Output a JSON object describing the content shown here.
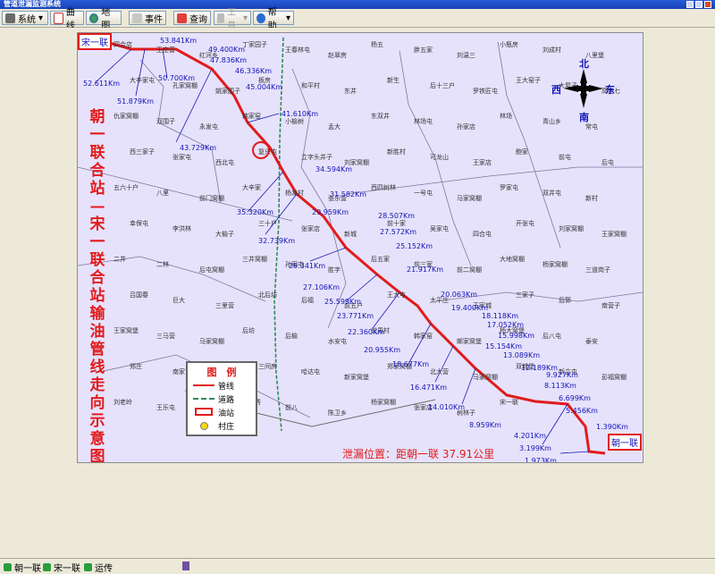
{
  "window": {
    "title": "管道泄漏监测系统"
  },
  "toolbar": {
    "system": "系统",
    "curve": "曲线",
    "map": "地图",
    "event": "事件",
    "query": "查询",
    "tools": "工具",
    "help": "帮助"
  },
  "map": {
    "vertical_title": "朝一联合站—宋一联合站输油管线走向示意图",
    "station_start": "宋一联",
    "station_end": "朝一联",
    "leak_text": "泄漏位置：距朝一联 37.91公里",
    "compass": {
      "north": "北",
      "south": "南",
      "east": "东",
      "west": "西"
    },
    "legend": {
      "title": "图　例",
      "items": [
        "管线",
        "道路",
        "油站",
        "村庄"
      ]
    },
    "distances": [
      "53.841Km",
      "52.611Km",
      "51.879Km",
      "50.700Km",
      "49.400Km",
      "47.836Km",
      "46.336Km",
      "45.004Km",
      "43.729Km",
      "41.610Km",
      "35.320Km",
      "34.594Km",
      "32.739Km",
      "31.582Km",
      "29.959Km",
      "29.341Km",
      "28.507Km",
      "27.572Km",
      "27.106Km",
      "25.599Km",
      "25.152Km",
      "23.771Km",
      "22.360Km",
      "21.917Km",
      "20.955Km",
      "20.063Km",
      "19.400Km",
      "18.677Km",
      "18.118Km",
      "17.052Km",
      "16.471Km",
      "15.998Km",
      "15.154Km",
      "14.010Km",
      "13.089Km",
      "12.189Km",
      "9.927Km",
      "8.959Km",
      "8.113Km",
      "6.699Km",
      "5.456Km",
      "4.201Km",
      "3.199Km",
      "1.973Km",
      "1.390Km"
    ],
    "places": [
      "四合店",
      "王空营",
      "红河乡",
      "丁家园子",
      "王春林屯",
      "赵翠房",
      "杨五",
      "胖五家",
      "刘温三",
      "小瓶房",
      "刘成村",
      "八里堡",
      "大辛家屯",
      "孔家窝棚",
      "姚家围子",
      "板房",
      "和平村",
      "东井",
      "新生",
      "后十三户",
      "罗铁匠屯",
      "王大窑子",
      "大屋子",
      "高老七",
      "仇家窝棚",
      "双围子",
      "永发屯",
      "韩家窑",
      "小榆树",
      "孟大",
      "东双井",
      "林场屯",
      "孙家店",
      "林场",
      "青山乡",
      "常屯",
      "西三家子",
      "张家屯",
      "西北屯",
      "复兴屯",
      "立字头井子",
      "刘家窝棚",
      "新胜村",
      "可龙山",
      "王家店",
      "鲍家",
      "前屯",
      "后屯",
      "五六十户",
      "八里",
      "前门窝棚",
      "大辛家",
      "杨发村",
      "张乐营",
      "西四树林",
      "一号屯",
      "马家窝棚",
      "罗家屯",
      "双井屯",
      "新村",
      "幸保屯",
      "李洪林",
      "大榆子",
      "三十户",
      "张家店",
      "新城",
      "前十家",
      "吴家屯",
      "四合屯",
      "开张屯",
      "刘家窝棚",
      "王家窝棚",
      "二井",
      "二林",
      "后屯窝棚",
      "三井窝棚",
      "孙家屯",
      "胜字",
      "后五家",
      "前三家",
      "前二窝棚",
      "大地窝棚",
      "杨家窝棚",
      "三道岗子",
      "吕国春",
      "巨大",
      "三里营",
      "北后坊",
      "后福",
      "前五户",
      "王大屯",
      "太平庄",
      "王家城",
      "三家子",
      "后郭",
      "南营子",
      "王家窝堡",
      "三马营",
      "马家窝棚",
      "后坊",
      "后榆",
      "水安屯",
      "前周村",
      "韩家窑",
      "邮家窝堡",
      "杨大窝堡",
      "后八屯",
      "泰安",
      "郑庄",
      "南家屯",
      "山门",
      "三间房",
      "哈达屯",
      "新家窝堡",
      "郑家窝棚",
      "北大营",
      "马家窝棚",
      "双城堡",
      "新立屯",
      "彭福窝棚",
      "刘老岭",
      "王乐屯",
      "李家村",
      "仁子秀",
      "前八",
      "陈卫乡",
      "杨家窝棚",
      "张家店",
      "树林子",
      "宋一联"
    ]
  },
  "statusbar": {
    "item1": "朝一联",
    "item2": "宋一联",
    "item3": "运传"
  },
  "colors": {
    "pipeline": "#e21b1b",
    "road": "#2e8b57",
    "map_bg": "#e6e2fc",
    "label_blue": "#1515b5"
  }
}
